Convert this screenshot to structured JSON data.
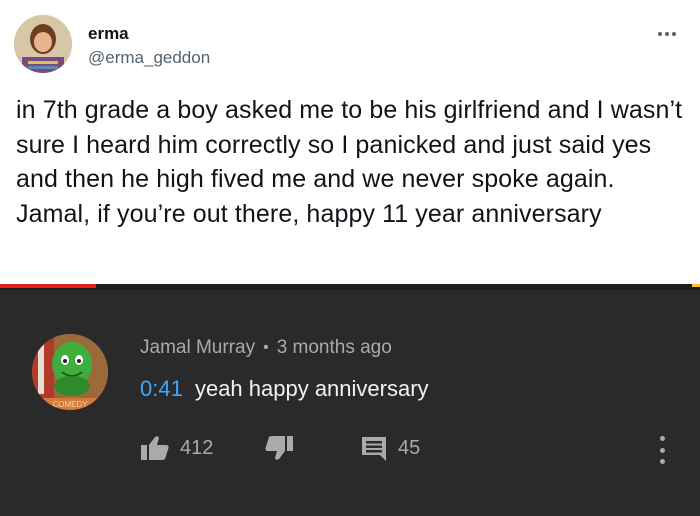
{
  "tweet": {
    "name": "erma",
    "handle": "@erma_geddon",
    "text": "in 7th grade a boy asked me to be his girlfriend and I wasn’t sure I heard him correctly so I panicked and just said yes and then he high fived me and we never spoke again. Jamal, if you’re out there, happy 11 year anniversary",
    "more_icon": "more-horizontal-icon"
  },
  "comment": {
    "author": "Jamal Murray",
    "separator": "•",
    "age": "3 months ago",
    "timestamp": "0:41",
    "text": "yeah happy anniversary",
    "likes": "412",
    "replies": "45",
    "avatar_text": "COMEDY",
    "icons": {
      "like": "thumbs-up-icon",
      "dislike": "thumbs-down-icon",
      "reply": "comment-icon",
      "menu": "more-vertical-icon"
    },
    "colors": {
      "background": "#2a2a2a",
      "timestamp_link": "#3ea6ff"
    }
  }
}
